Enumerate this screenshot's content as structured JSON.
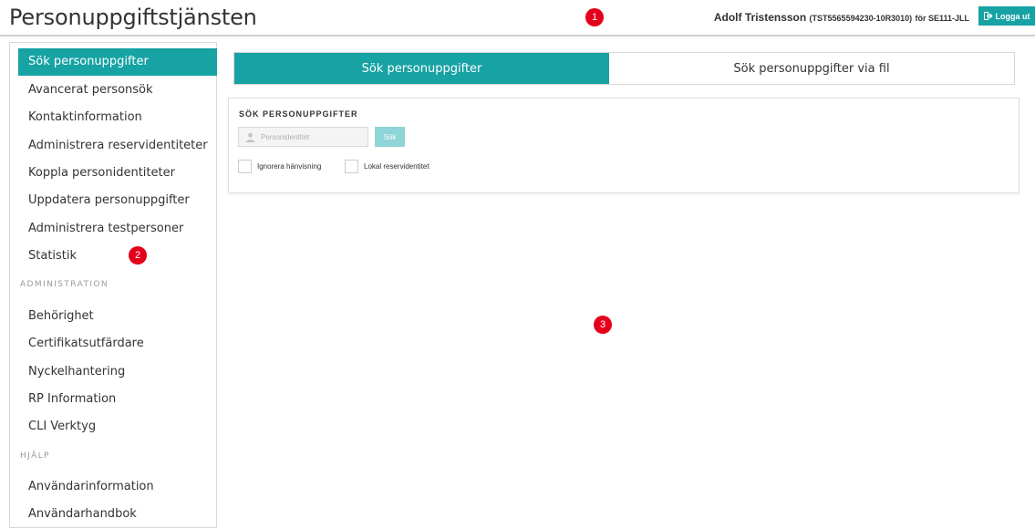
{
  "header": {
    "title": "Personuppgiftstjänsten",
    "user_name": "Adolf Tristensson",
    "user_id": "(TST5565594230-10R3010)",
    "user_for": "för SE111-JLL",
    "logout_label": "Logga ut"
  },
  "markers": [
    "1",
    "2",
    "3"
  ],
  "sidebar": {
    "items": [
      {
        "label": "Sök personuppgifter",
        "active": true
      },
      {
        "label": "Avancerat personsök"
      },
      {
        "label": "Kontaktinformation"
      },
      {
        "label": "Administrera reservidentiteter"
      },
      {
        "label": "Koppla personidentiteter"
      },
      {
        "label": "Uppdatera personuppgifter"
      },
      {
        "label": "Administrera testpersoner"
      },
      {
        "label": "Statistik"
      }
    ],
    "admin_section": "ADMINISTRATION",
    "admin_items": [
      {
        "label": "Behörighet"
      },
      {
        "label": "Certifikatsutfärdare"
      },
      {
        "label": "Nyckelhantering"
      },
      {
        "label": "RP Information"
      },
      {
        "label": "CLI Verktyg"
      }
    ],
    "help_section": "HJÄLP",
    "help_items": [
      {
        "label": "Användarinformation"
      },
      {
        "label": "Användarhandbok"
      }
    ]
  },
  "main": {
    "tabs": [
      {
        "label": "Sök personuppgifter",
        "active": true
      },
      {
        "label": "Sök personuppgifter via fil"
      }
    ],
    "panel": {
      "title": "SÖK PERSONUPPGIFTER",
      "input_placeholder": "Personidentitet",
      "input_value": "",
      "search_label": "Sök",
      "checkbox_ignore": "Ignorera hänvisning",
      "checkbox_local": "Lokal reservidentitet"
    }
  },
  "colors": {
    "accent": "#17a2a4",
    "accent_disabled": "#8fd4d6",
    "marker": "#e3001b"
  }
}
